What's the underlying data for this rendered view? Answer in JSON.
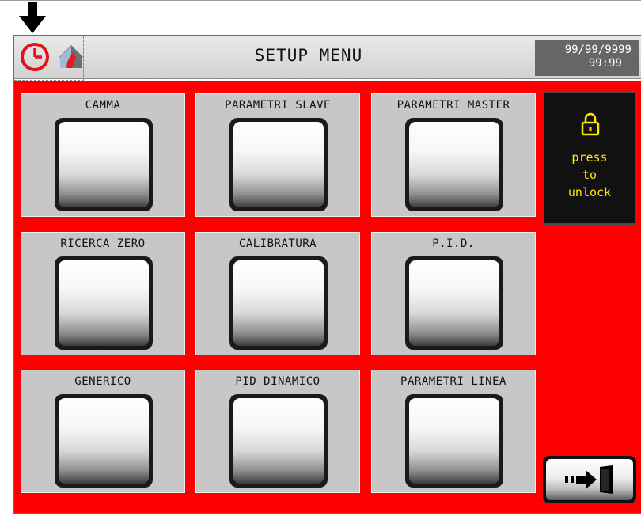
{
  "header": {
    "title": "SETUP MENU",
    "date": "99/99/9999",
    "time": "99:99",
    "clock_icon": "clock-icon",
    "house_icon": "house-icon",
    "arrow_icon": "down-arrow-icon"
  },
  "buttons": [
    {
      "label": "CAMMA"
    },
    {
      "label": "PARAMETRI SLAVE"
    },
    {
      "label": "PARAMETRI MASTER"
    },
    {
      "label": "RICERCA ZERO"
    },
    {
      "label": "CALIBRATURA"
    },
    {
      "label": "P.I.D."
    },
    {
      "label": "GENERICO"
    },
    {
      "label": "PID DINAMICO"
    },
    {
      "label": "PARAMETRI LINEA"
    }
  ],
  "lock": {
    "line1": "press",
    "line2": "to",
    "line3": "unlock",
    "icon": "padlock-icon"
  },
  "exit": {
    "icon": "exit-door-icon"
  },
  "colors": {
    "background_panel": "#ff0000",
    "button_card": "#c7c7c7",
    "lock_text": "#ffe800",
    "datetime_bg": "#666666"
  }
}
